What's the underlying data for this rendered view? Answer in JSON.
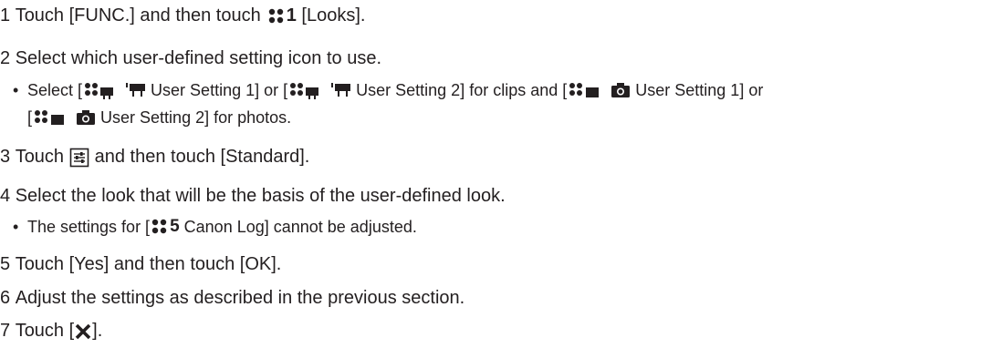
{
  "steps": [
    {
      "num": "1",
      "text_a": "Touch [FUNC.] and then touch",
      "icon_num": "1",
      "text_b": "[Looks]."
    },
    {
      "num": "2",
      "text_a": "Select which user-defined setting icon to use."
    },
    {
      "num": "3",
      "text_a": "Touch",
      "text_b": "and then touch [Standard]."
    },
    {
      "num": "4",
      "text_a": "Select the look that will be the basis of the user-defined look."
    },
    {
      "num": "5",
      "text_a": "Touch [Yes] and then touch [OK]."
    },
    {
      "num": "6",
      "text_a": "Adjust the settings as described in the previous section."
    },
    {
      "num": "7",
      "text_a": "Touch [",
      "text_b": "]."
    }
  ],
  "sub2": {
    "bullet": "•",
    "t1": "Select [",
    "t2": "User Setting 1] or [",
    "t3": "User Setting 2] for clips and [",
    "t4": "User Setting 1] or",
    "t5": "[",
    "t6": "User Setting 2] for photos."
  },
  "sub4": {
    "bullet": "•",
    "t1": "The settings for [",
    "icon_num": "5",
    "t2": "Canon Log] cannot be adjusted."
  },
  "icons": [
    "look-icon",
    "movie-user-icon",
    "film-camera-icon",
    "photo-user-icon",
    "camera-icon",
    "adjust-icon",
    "close-x-icon"
  ],
  "colors": {
    "text": "#231f20",
    "background": "#ffffff"
  }
}
